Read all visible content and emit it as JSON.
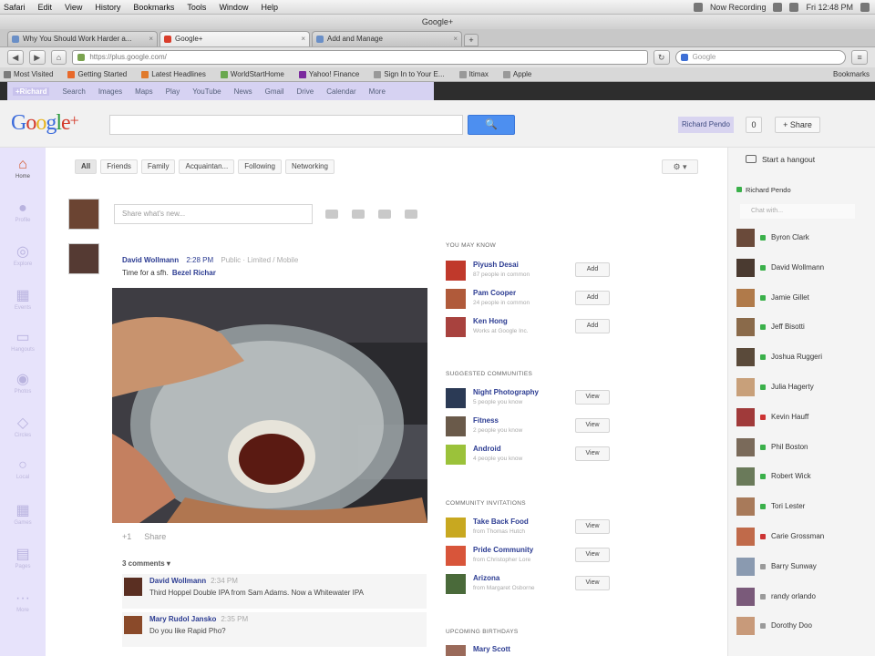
{
  "menubar": {
    "items": [
      "Safari",
      "Edit",
      "View",
      "History",
      "Bookmarks",
      "Tools",
      "Window",
      "Help"
    ],
    "recording": "Now Recording",
    "clock": "Fri 12:48 PM"
  },
  "browser": {
    "title": "Google+",
    "tabs": [
      {
        "label": "Why You Should Work Harder a...",
        "active": false
      },
      {
        "label": "Google+",
        "active": true
      },
      {
        "label": "Add and Manage",
        "active": false
      }
    ],
    "new_tab": "+",
    "url": "https://plus.google.com/",
    "search_placeholder": "Google",
    "bookmarks": [
      {
        "label": "Most Visited",
        "color": "#7b7b7b"
      },
      {
        "label": "Getting Started",
        "color": "#e86a2b"
      },
      {
        "label": "Latest Headlines",
        "color": "#e07a2c"
      },
      {
        "label": "WorldStartHome",
        "color": "#6aa84f"
      },
      {
        "label": "Yahoo! Finance",
        "color": "#7b2a9e"
      },
      {
        "label": "Sign In to Your E...",
        "color": "#999999"
      },
      {
        "label": "Itimax",
        "color": "#999999"
      },
      {
        "label": "Apple",
        "color": "#999999"
      }
    ],
    "bookmarks_right": "Bookmarks"
  },
  "gbar": {
    "links": [
      "+Richard",
      "Search",
      "Images",
      "Maps",
      "Play",
      "YouTube",
      "News",
      "Gmail",
      "Drive",
      "Calendar",
      "More"
    ]
  },
  "header": {
    "search_button": "🔍",
    "profile_name": "Richard Pendo",
    "notifications": "0",
    "share": "+ Share"
  },
  "rail": {
    "home": "Home",
    "items": [
      "Profile",
      "Explore",
      "Events",
      "Hangouts",
      "Photos",
      "Circles",
      "Local",
      "Games",
      "Pages",
      "More"
    ]
  },
  "filters": {
    "chips": [
      "All",
      "Friends",
      "Family",
      "Acquaintan...",
      "Following",
      "Networking"
    ],
    "gear": "⚙ ▾"
  },
  "sharebox": {
    "placeholder": "Share what's new..."
  },
  "post": {
    "author": "David Wollmann",
    "time": "2:28 PM",
    "meta": "Public · Limited / Mobile",
    "text": "Time for a sfh.",
    "mention": "Bezel Richar",
    "actions": [
      "+1",
      "Share"
    ],
    "comments_count": "3 comments ▾",
    "comments": [
      {
        "author": "David Wollmann",
        "time": "2:34 PM",
        "text": "Third Hoppel Double IPA from Sam Adams. Now a Whitewater IPA",
        "avatar_color": "#5a2f22"
      },
      {
        "author": "Mary Rudol Jansko",
        "time": "2:35 PM",
        "text": "Do you like Rapid Pho?",
        "avatar_color": "#8a4a2a"
      }
    ]
  },
  "suggestions": {
    "people_title": "You may know",
    "people": [
      {
        "name": "Piyush Desai",
        "sub": "87 people in common",
        "btn": "Add",
        "color": "#c0392b"
      },
      {
        "name": "Pam Cooper",
        "sub": "24 people in common",
        "btn": "Add",
        "color": "#b05a3a"
      },
      {
        "name": "Ken Hong",
        "sub": "Works at Google Inc.",
        "btn": "Add",
        "color": "#a8423e"
      }
    ],
    "communities_title": "Suggested communities",
    "communities": [
      {
        "name": "Night Photography",
        "sub": "5 people you know",
        "btn": "View",
        "color": "#2b3a55"
      },
      {
        "name": "Fitness",
        "sub": "2 people you know",
        "btn": "View",
        "color": "#6a5a4a"
      },
      {
        "name": "Android",
        "sub": "4 people you know",
        "btn": "View",
        "color": "#9bc23a"
      }
    ],
    "invitations_title": "Community invitations",
    "invitations": [
      {
        "name": "Take Back Food",
        "sub": "from Thomas Hutch",
        "btn": "View",
        "color": "#c8a820"
      },
      {
        "name": "Pride Community",
        "sub": "from Christopher Lore",
        "btn": "View",
        "color": "#d8553a"
      },
      {
        "name": "Arizona",
        "sub": "from Margaret Osborne",
        "btn": "View",
        "color": "#4a6a3a"
      }
    ],
    "upcoming_title": "Upcoming birthdays",
    "upcoming": [
      {
        "name": "Mary Scott",
        "sub": "",
        "btn": "",
        "color": "#9a6a5a"
      }
    ]
  },
  "chat": {
    "hangout": "Start a hangout",
    "self": "Richard Pendo",
    "search_placeholder": "Chat with...",
    "contacts": [
      {
        "name": "Byron Clark",
        "status": "#3ab04a",
        "color": "#6a4a3a"
      },
      {
        "name": "David Wollmann",
        "status": "#3ab04a",
        "color": "#4a3a30"
      },
      {
        "name": "Jamie Gillet",
        "status": "#3ab04a",
        "color": "#b07a4a"
      },
      {
        "name": "Jeff Bisotti",
        "status": "#3ab04a",
        "color": "#8a6a4a"
      },
      {
        "name": "Joshua Ruggeri",
        "status": "#3ab04a",
        "color": "#5a4a3a"
      },
      {
        "name": "Julia Hagerty",
        "status": "#3ab04a",
        "color": "#c8a07a"
      },
      {
        "name": "Kevin Hauff",
        "status": "#cc3333",
        "color": "#a03a3a"
      },
      {
        "name": "Phil Boston",
        "status": "#3ab04a",
        "color": "#7a6a5a"
      },
      {
        "name": "Robert Wick",
        "status": "#3ab04a",
        "color": "#6a7a5a"
      },
      {
        "name": "Tori Lester",
        "status": "#3ab04a",
        "color": "#a87a5a"
      },
      {
        "name": "Carie Grossman",
        "status": "#cc3333",
        "color": "#c06a4a"
      },
      {
        "name": "Barry Sunway",
        "status": "#9a9a9a",
        "color": "#8a9ab0"
      },
      {
        "name": "randy orlando",
        "status": "#9a9a9a",
        "color": "#7a5a7a"
      },
      {
        "name": "Dorothy Doo",
        "status": "#9a9a9a",
        "color": "#c89a7a"
      }
    ]
  }
}
